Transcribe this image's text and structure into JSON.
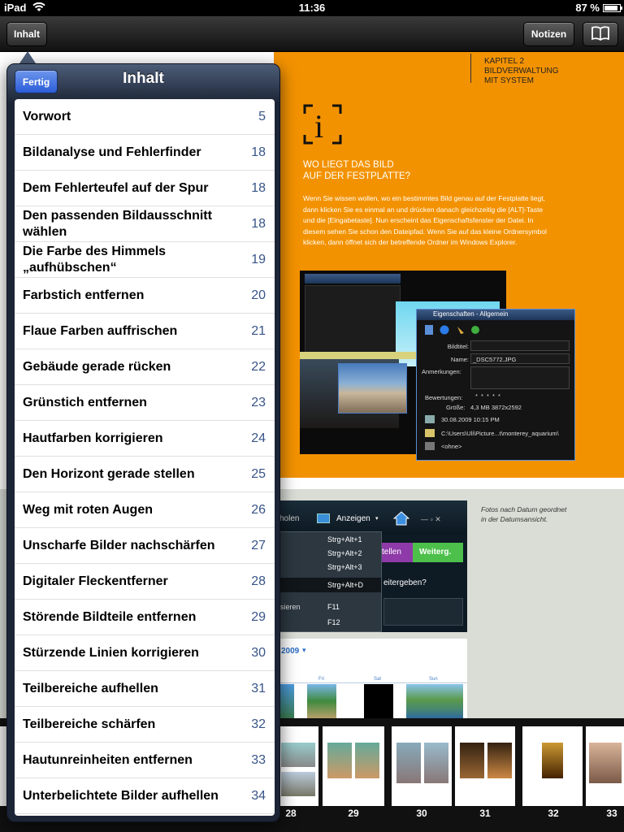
{
  "status_bar": {
    "carrier": "iPad",
    "time": "11:36",
    "battery": "87 %",
    "battery_level": 0.87
  },
  "toolbar": {
    "contents_label": "Inhalt",
    "notes_label": "Notizen"
  },
  "popover": {
    "title": "Inhalt",
    "done_label": "Fertig",
    "items": [
      {
        "title": "Vorwort",
        "page": "5"
      },
      {
        "title": "Bildanalyse und Fehlerfinder",
        "page": "18"
      },
      {
        "title": "Dem Fehlerteufel auf der Spur",
        "page": "18"
      },
      {
        "title": "Den passenden Bildausschnitt wählen",
        "page": "18"
      },
      {
        "title": "Die Farbe des Himmels „aufhübschen“",
        "page": "19"
      },
      {
        "title": "Farbstich entfernen",
        "page": "20"
      },
      {
        "title": "Flaue Farben auffrischen",
        "page": "21"
      },
      {
        "title": "Gebäude gerade rücken",
        "page": "22"
      },
      {
        "title": "Grünstich entfernen",
        "page": "23"
      },
      {
        "title": "Hautfarben korrigieren",
        "page": "24"
      },
      {
        "title": "Den Horizont gerade stellen",
        "page": "25"
      },
      {
        "title": "Weg mit roten Augen",
        "page": "26"
      },
      {
        "title": "Unscharfe Bilder nachschärfen",
        "page": "27"
      },
      {
        "title": "Digitaler Fleckentferner",
        "page": "28"
      },
      {
        "title": "Störende Bildteile entfernen",
        "page": "29"
      },
      {
        "title": "Stürzende Linien korrigieren",
        "page": "30"
      },
      {
        "title": "Teilbereiche aufhellen",
        "page": "31"
      },
      {
        "title": "Teilbereiche schärfen",
        "page": "32"
      },
      {
        "title": "Hautunreinheiten entfernen",
        "page": "33"
      },
      {
        "title": "Unterbelichtete Bilder aufhellen",
        "page": "34"
      }
    ]
  },
  "book_page": {
    "chapter_line1": "KAPITEL 2",
    "chapter_line2": "BILDVERWALTUNG",
    "chapter_line3": "MIT SYSTEM",
    "info_symbol": "i",
    "tip_heading_line1": "WO LIEGT DAS BILD",
    "tip_heading_line2": "AUF DER FESTPLATTE?",
    "tip_body": "Wenn Sie wissen wollen, wo ein bestimmtes Bild genau auf der Festplatte liegt, dann klicken Sie es einmal an und drücken danach gleichzeitig die [ALT]-Taste und die [Eingabetaste]. Nun erscheint das Eigenschaftsfenster der Datei. In diesem sehen Sie schon den Dateipfad. Wenn Sie auf das kleine Ordnersymbol klicken, dann öffnet sich der betreffende Ordner im Windows Explorer.",
    "caption_line1": "Fotos nach Datum geordnet",
    "caption_line2": "in der Datumsansicht.",
    "props_window": {
      "title": "Eigenschaften - Allgemein",
      "label_title": "Bildtitel:",
      "label_name": "Name:",
      "name_value": "_DSC5772.JPG",
      "label_notes": "Anmerkungen:",
      "label_rating": "Bewertungen:",
      "rating_stars": "* * * * *",
      "label_size": "Größe:",
      "size_value": "4,3 MB  3872x2592",
      "date_value": "30.08.2009 10:15 PM",
      "path_value": "C:\\Users\\Uli\\Picture...t\\monterey_aquarium\\",
      "tag_value": "<ohne>"
    },
    "menu_shot": {
      "tab_partial": "holen",
      "menu_label": "Anzeigen",
      "shortcuts": [
        "Strg+Alt+1",
        "Strg+Alt+2",
        "Strg+Alt+3",
        "Strg+Alt+D",
        "F11",
        "F12"
      ],
      "partial_item": "isieren",
      "btn_partial": "tellen",
      "btn_next": "Weiterg.",
      "question_partial": "eitergeben?"
    },
    "calendar_shot": {
      "year_label": "2009",
      "days": [
        "Fri",
        "Sat",
        "Sun"
      ]
    }
  },
  "filmstrip": {
    "pages": [
      "28",
      "29",
      "30",
      "31",
      "32",
      "33"
    ]
  },
  "colors": {
    "accent_orange": "#f39200",
    "popover_blue": "#2a5cd8",
    "page_number": "#385487"
  }
}
